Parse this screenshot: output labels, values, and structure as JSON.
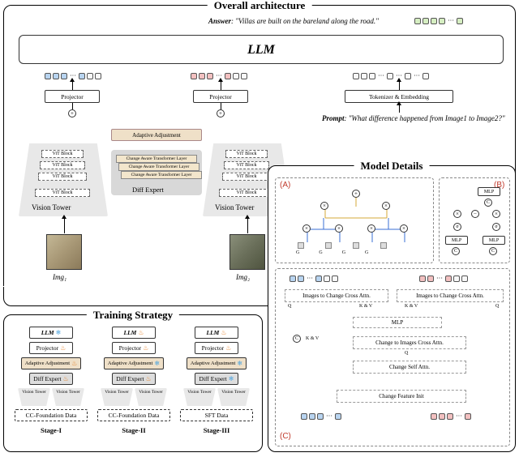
{
  "panels": {
    "overall": "Overall architecture",
    "training": "Training Strategy",
    "details": "Model Details"
  },
  "top": {
    "answer_prefix": "Answer",
    "answer_text": "\"Villas are built on the bareland along the road.\"",
    "llm": "LLM",
    "projector": "Projector",
    "tokenizer": "Tokenizer & Embedding",
    "prompt_prefix": "Prompt",
    "prompt_text": "\"What difference happened from Image1 to Image2?\"",
    "adaptive": "Adaptive  Adjustment",
    "vit": "ViT Block",
    "diff_expert": "Diff Expert",
    "change_layer": "Change Aware Transformer Layer",
    "vision_tower": "Vision Tower",
    "img1": "Img₁",
    "img2": "Img₂"
  },
  "training": {
    "llm": "LLM",
    "projector": "Projector",
    "adaptive": "Adaptive  Adjustment",
    "diff_expert": "Diff Expert",
    "vision_tower": "Vision Tower",
    "cc": "CC-Foundation Data",
    "sft": "SFT Data",
    "s1": "Stage-I",
    "s2": "Stage-II",
    "s3": "Stage-III"
  },
  "details": {
    "A": "(A)",
    "B": "(B)",
    "C": "(C)",
    "mlp": "MLP",
    "g": "G",
    "c": "C",
    "sigma": "σ",
    "i2c": "Images to Change Cross Attn.",
    "c2i": "Change to Images Cross Attn.",
    "cself": "Change Self Attn.",
    "cinit": "Change Feature Init",
    "q": "Q",
    "kv": "K & V"
  }
}
